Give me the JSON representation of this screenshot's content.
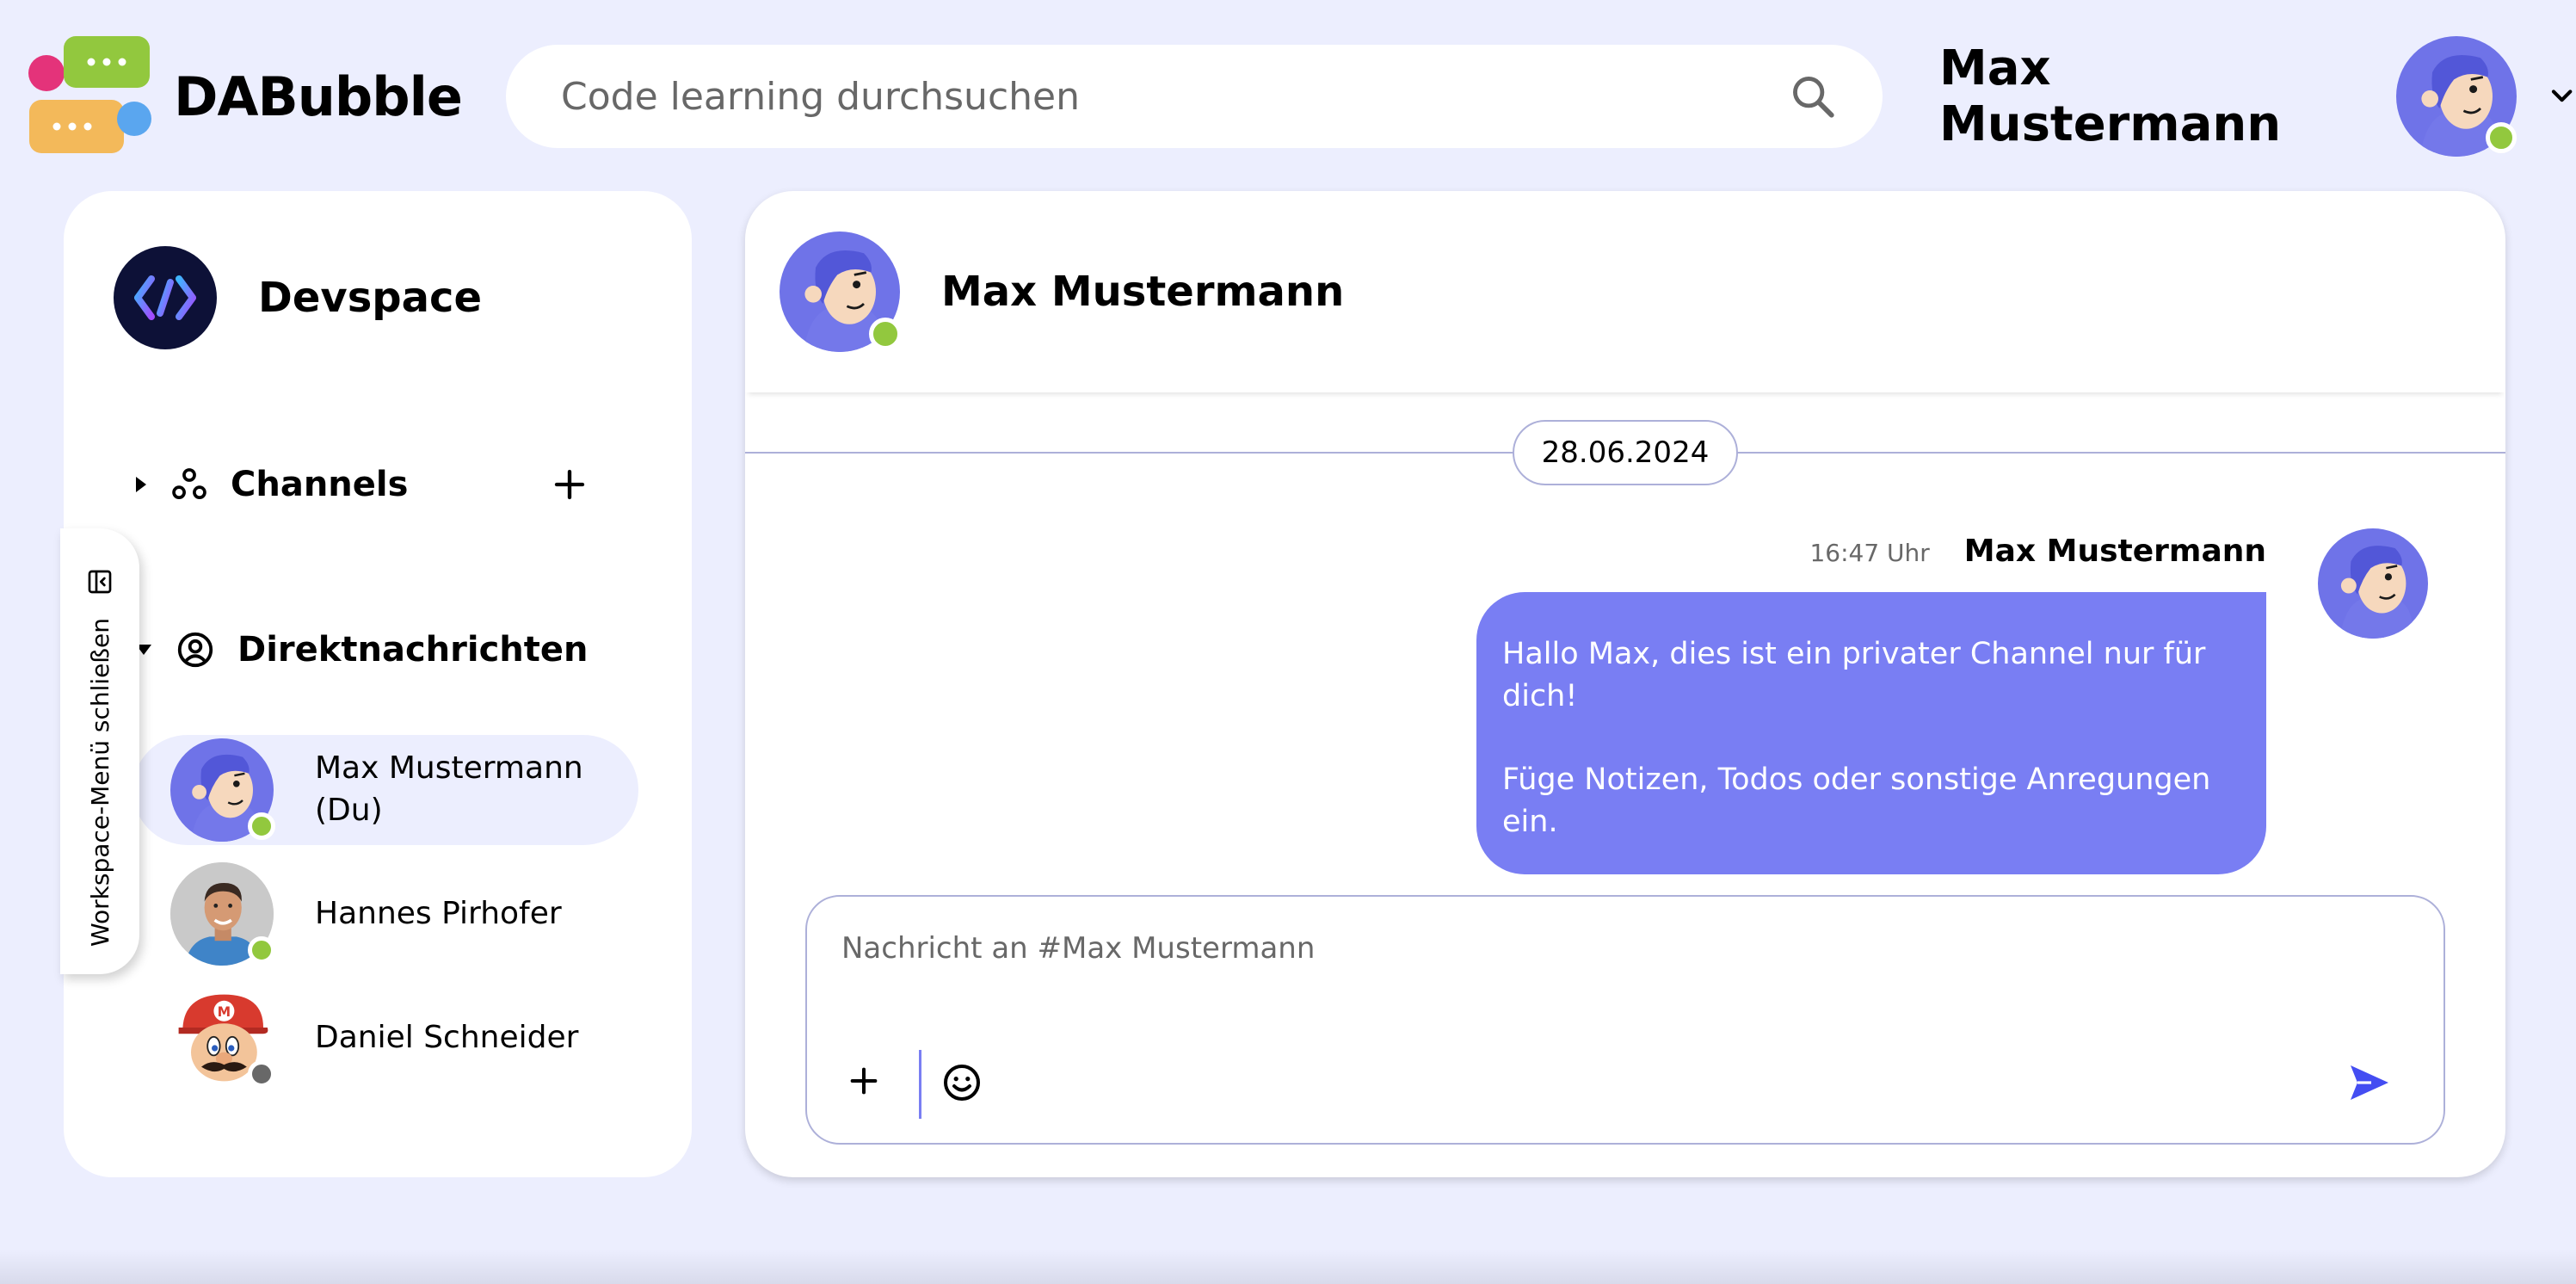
{
  "app": {
    "name": "DABubble"
  },
  "search": {
    "placeholder": "Code learning durchsuchen"
  },
  "user": {
    "name": "Max Mustermann",
    "status": "online"
  },
  "workspace": {
    "name": "Devspace"
  },
  "sidebar": {
    "channels_label": "Channels",
    "dm_label": "Direktnachrichten",
    "toggle_label": "Workspace-Menü schließen",
    "direct_messages": [
      {
        "line1": "Max Mustermann",
        "line2": "(Du)",
        "status": "online",
        "active": true
      },
      {
        "line1": "Hannes Pirhofer",
        "line2": "",
        "status": "online",
        "active": false
      },
      {
        "line1": "Daniel Schneider",
        "line2": "",
        "status": "offline",
        "active": false
      }
    ]
  },
  "chat": {
    "title": "Max Mustermann",
    "date": "28.06.2024",
    "message": {
      "time": "16:47 Uhr",
      "author": "Max Mustermann",
      "line1": "Hallo Max, dies ist ein privater Channel nur für dich!",
      "line2": "Füge Notizen, Todos oder sonstige Anregungen ein."
    },
    "composer": {
      "placeholder": "Nachricht an #Max Mustermann"
    }
  },
  "colors": {
    "background": "#eceefe",
    "accent": "#797ef3",
    "accent_dark": "#444df2",
    "border": "#adb0d9",
    "online": "#92c83e",
    "offline": "#686868"
  },
  "icons": {
    "search": "search-icon",
    "chevron": "chevron-down-icon",
    "channels": "channels-icon",
    "add": "plus-icon",
    "dm": "account-circle-icon",
    "toggle": "sidebar-collapse-icon",
    "emoji": "emoji-icon",
    "send": "send-icon"
  }
}
